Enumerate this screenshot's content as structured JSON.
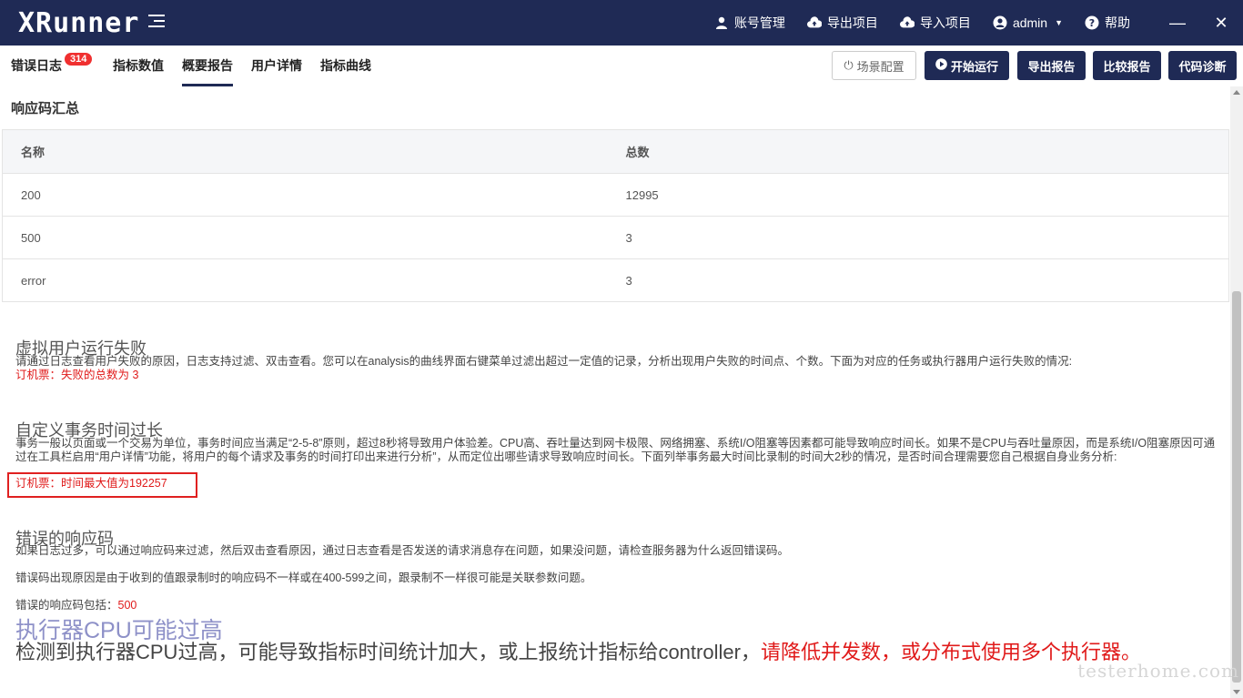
{
  "app": {
    "logo": "XRunner"
  },
  "topbar": {
    "account": "账号管理",
    "export_project": "导出项目",
    "import_project": "导入项目",
    "user": "admin",
    "help": "帮助",
    "minimize": "—",
    "close": "✕"
  },
  "tabs": [
    {
      "label": "错误日志"
    },
    {
      "label": "指标数值"
    },
    {
      "label": "概要报告"
    },
    {
      "label": "用户详情"
    },
    {
      "label": "指标曲线"
    }
  ],
  "error_badge": "314",
  "toolbar": {
    "scene_config": "场景配置",
    "start_run": "开始运行",
    "export_report": "导出报告",
    "compare_report": "比较报告",
    "code_diagnose": "代码诊断"
  },
  "response_summary": {
    "title": "响应码汇总",
    "headers": [
      "名称",
      "总数"
    ],
    "rows": [
      [
        "200",
        "12995"
      ],
      [
        "500",
        "3"
      ],
      [
        "error",
        "3"
      ]
    ]
  },
  "vuser_fail": {
    "title": "虚拟用户运行失败",
    "desc": "请通过日志查看用户失败的原因，日志支持过滤、双击查看。您可以在analysis的曲线界面右键菜单过滤出超过一定值的记录，分析出现用户失败的时间点、个数。下面为对应的任务或执行器用户运行失败的情况:",
    "result": "订机票：失败的总数为 3"
  },
  "txn_time": {
    "title": "自定义事务时间过长",
    "desc": "事务一般以页面或一个交易为单位，事务时间应当满足“2-5-8”原则，超过8秒将导致用户体验差。CPU高、吞吐量达到网卡极限、网络拥塞、系统I/O阻塞等因素都可能导致响应时间长。如果不是CPU与吞吐量原因，而是系统I/O阻塞原因可通过在工具栏启用“用户详情”功能，将用户的每个请求及事务的时间打印出来进行分析”，从而定位出哪些请求导致响应时间长。下面列举事务最大时间比录制的时间大2秒的情况，是否时间合理需要您自己根据自身业务分析:",
    "result": "订机票：时间最大值为192257"
  },
  "error_codes": {
    "title": "错误的响应码",
    "desc1": "如果日志过多，可以通过响应码来过滤，然后双击查看原因，通过日志查看是否发送的请求消息存在问题，如果没问题，请检查服务器为什么返回错误码。",
    "desc2": "错误码出现原因是由于收到的值跟录制时的响应码不一样或在400-599之间，跟录制不一样很可能是关联参数问题。",
    "include_label": "错误的响应码包括：",
    "include_value": "500"
  },
  "cpu_high": {
    "title": "执行器CPU可能过高",
    "text": "检测到执行器CPU过高，可能导致指标时间统计加大，或上报统计指标给controller，",
    "highlight": "请降低并发数，或分布式使用多个执行器。"
  },
  "watermark": "testerhome.com",
  "colors": {
    "topbar": "#1f2a55",
    "accent_red": "#e01a1a",
    "badge": "#f03030"
  }
}
